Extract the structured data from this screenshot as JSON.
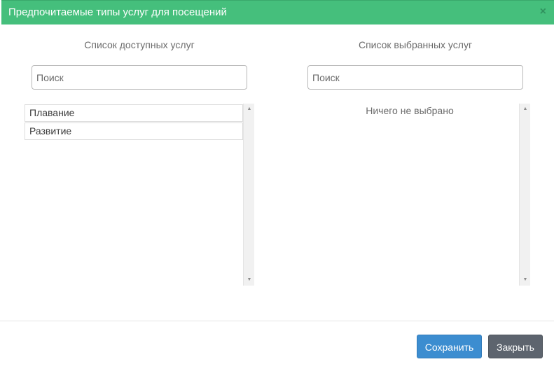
{
  "dialog": {
    "title": "Предпочитаемые типы услуг для посещений",
    "close_symbol": "×"
  },
  "available": {
    "title": "Список доступных услуг",
    "search_placeholder": "Поиск",
    "items": [
      {
        "label": "Плавание"
      },
      {
        "label": "Развитие"
      }
    ]
  },
  "selected": {
    "title": "Список выбранных услуг",
    "search_placeholder": "Поиск",
    "empty_text": "Ничего не выбрано",
    "items": []
  },
  "scrollbar": {
    "up_symbol": "▲",
    "down_symbol": "▼"
  },
  "footer": {
    "save_label": "Сохранить",
    "close_label": "Закрыть"
  },
  "colors": {
    "header_bg": "#45bf7c",
    "save_bg": "#3c8dd0",
    "close_bg": "#5d646e"
  }
}
